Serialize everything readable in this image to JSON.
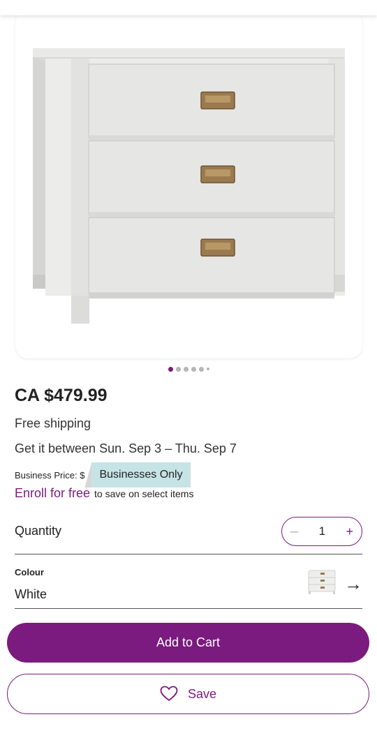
{
  "product": {
    "image_alt": "White three-drawer dresser",
    "carousel_total": 6,
    "carousel_active": 0
  },
  "pricing": {
    "price": "CA $479.99",
    "shipping": "Free shipping",
    "delivery": "Get it between Sun. Sep 3 – Thu. Sep 7",
    "business_label": "Business Price: $",
    "business_badge": "Businesses Only",
    "enroll_link": "Enroll for free",
    "enroll_sub": "to save on select items"
  },
  "quantity": {
    "label": "Quantity",
    "value": "1",
    "minus": "–",
    "plus": "+"
  },
  "colour": {
    "label": "Colour",
    "value": "White",
    "arrow": "→"
  },
  "actions": {
    "add_to_cart": "Add to Cart",
    "save": "Save"
  },
  "colors": {
    "brand_purple": "#7b1a7f",
    "badge_teal": "#c6e4e6"
  },
  "icons": {
    "save": "heart-icon",
    "colour_next": "arrow-right-icon"
  }
}
